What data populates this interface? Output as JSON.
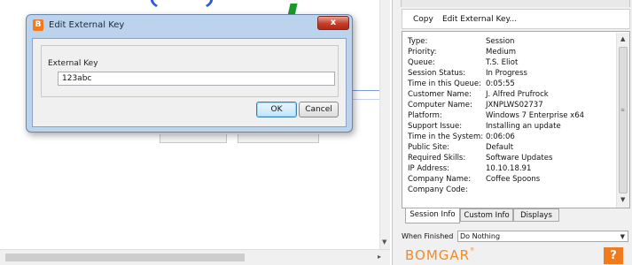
{
  "dialog": {
    "title": "Edit External Key",
    "title_icon_letter": "B",
    "close_symbol": "x",
    "field_label": "External Key",
    "field_value": "123abc",
    "ok_label": "OK",
    "cancel_label": "Cancel"
  },
  "right_panel": {
    "menu": [
      "Copy",
      "Edit External Key..."
    ],
    "session_info": [
      {
        "label": "Type:",
        "value": "Session"
      },
      {
        "label": "Priority:",
        "value": "Medium"
      },
      {
        "label": "Queue:",
        "value": "T.S. Eliot"
      },
      {
        "label": "Session Status:",
        "value": "In Progress"
      },
      {
        "label": "Time in this Queue:",
        "value": "0:05:55"
      },
      {
        "label": "Customer Name:",
        "value": "J. Alfred Prufrock"
      },
      {
        "label": "Computer Name:",
        "value": "JXNPLWS02737"
      },
      {
        "label": "Platform:",
        "value": "Windows 7 Enterprise x64"
      },
      {
        "label": "Support Issue:",
        "value": "Installing an update"
      },
      {
        "label": "Time in the System:",
        "value": "0:06:06"
      },
      {
        "label": "Public Site:",
        "value": "Default"
      },
      {
        "label": "Required Skills:",
        "value": "Software Updates"
      },
      {
        "label": "IP Address:",
        "value": "10.10.18.91"
      },
      {
        "label": "Company Name:",
        "value": "Coffee Spoons"
      },
      {
        "label": "Company Code:",
        "value": ""
      }
    ],
    "tabs": [
      "Session Info",
      "Custom Info",
      "Displays"
    ],
    "when_finished_label": "When Finished",
    "when_finished_value": "Do Nothing",
    "brand": "BOMGAR",
    "brand_mark": "®",
    "help_symbol": "?"
  },
  "colors": {
    "accent_orange": "#f07a1c",
    "dialog_frame": "#bcd3ee",
    "close_red": "#c4402a"
  }
}
